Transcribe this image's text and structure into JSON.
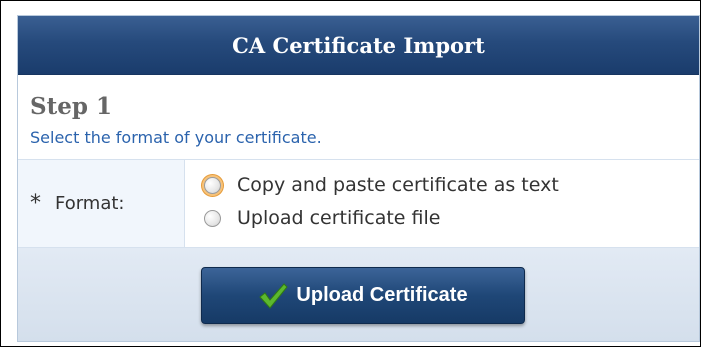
{
  "dialog": {
    "title": "CA Certificate Import"
  },
  "step": {
    "title": "Step 1",
    "description": "Select the format of your certificate."
  },
  "format": {
    "required_marker": "*",
    "label": "Format:",
    "options": [
      {
        "label": "Copy and paste certificate as text",
        "selected": false,
        "focused": true
      },
      {
        "label": "Upload certificate file",
        "selected": false,
        "focused": false
      }
    ]
  },
  "actions": {
    "upload_label": "Upload Certificate",
    "upload_icon": "checkmark-icon"
  },
  "colors": {
    "header": "#264a7c",
    "step_desc": "#2b63ad",
    "check": "#5cb82e"
  }
}
